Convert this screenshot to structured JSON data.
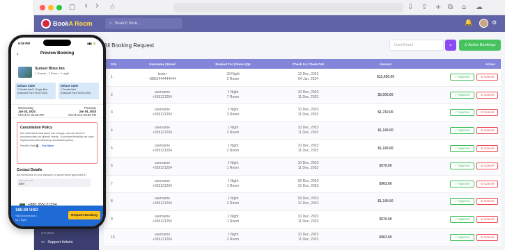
{
  "browser": {
    "back": "‹",
    "forward": "›",
    "tab_icon": "▢",
    "star": "☆"
  },
  "appbar": {
    "logo_text_1": "Book",
    "logo_text_2": "A Room",
    "search_placeholder": "Search here...",
    "search_icon": "⌕",
    "bell_icon": "🔔",
    "gear_icon": "⚙"
  },
  "page": {
    "title": "All Booking Request",
    "filter_placeholder": "User/Email",
    "filter_search_icon": "⌕",
    "active_button": "⊙ Active Bookings"
  },
  "table": {
    "headers": [
      "S.N.",
      "Username | Email",
      "Booked For | Room Qty",
      "Check In | Check Out",
      "Amount",
      "Action"
    ],
    "approve_label": "✓ Approve",
    "cancel_label": "⊘ Cancel",
    "rows": [
      {
        "sn": "1",
        "user": "tester",
        "email": "+8801444444444",
        "booked": "33 Night",
        "rooms": "2 Room",
        "checkin": "12 Dec, 2023",
        "checkout": "04 Jan, 2024",
        "amount": "$12,450.00"
      },
      {
        "sn": "2",
        "user": "username",
        "email": "+355121254",
        "booked": "1 Night",
        "rooms": "7 Room",
        "checkin": "10 Dec, 2023",
        "checkout": "11 Dec, 2023",
        "amount": "$3,005.60"
      },
      {
        "sn": "3",
        "user": "username",
        "email": "+355121254",
        "booked": "1 Night",
        "rooms": "3 Room",
        "checkin": "10 Dec, 2023",
        "checkout": "11 Dec, 2023",
        "amount": "$1,710.00"
      },
      {
        "sn": "4",
        "user": "username",
        "email": "+355121254",
        "booked": "1 Night",
        "rooms": "2 Room",
        "checkin": "10 Dec, 2023",
        "checkout": "11 Dec, 2023",
        "amount": "$1,140.00"
      },
      {
        "sn": "5",
        "user": "username",
        "email": "+355121254",
        "booked": "1 Night",
        "rooms": "2 Room",
        "checkin": "10 Dec, 2023",
        "checkout": "11 Dec, 2023",
        "amount": "$1,140.00"
      },
      {
        "sn": "6",
        "user": "username",
        "email": "+355121254",
        "booked": "1 Night",
        "rooms": "1 Room",
        "checkin": "10 Dec, 2023",
        "checkout": "11 Dec, 2023",
        "amount": "$570.00"
      },
      {
        "sn": "7",
        "user": "username",
        "email": "+355121254",
        "booked": "1 Night",
        "rooms": "1 Room",
        "checkin": "09 Dec, 2023",
        "checkout": "10 Dec, 2023",
        "amount": "$963.60"
      },
      {
        "sn": "8",
        "user": "username",
        "email": "+355121254",
        "booked": "1 Night",
        "rooms": "2 Room",
        "checkin": "09 Dec, 2023",
        "checkout": "10 Dec, 2023",
        "amount": "$1,140.00"
      },
      {
        "sn": "9",
        "user": "username",
        "email": "+355121254",
        "booked": "1 Night",
        "rooms": "1 Room",
        "checkin": "10 Dec, 2023",
        "checkout": "11 Dec, 2023",
        "amount": "$570.00"
      },
      {
        "sn": "10",
        "user": "username",
        "email": "+355121254",
        "booked": "1 Night",
        "rooms": "2 Room",
        "checkin": "10 Dec, 2023",
        "checkout": "11 Dec, 2023",
        "amount": "$963.60"
      }
    ]
  },
  "sidebar": {
    "others_label": "OTHERS",
    "support_label": "Support tickets",
    "support_icon": "▭"
  },
  "phone": {
    "time": "6:39 PM",
    "status_right": "▮▮▮ 🔋",
    "title": "Preview Booking",
    "back_icon": "‹",
    "hotel_name": "Sunset Bliss Inn",
    "hotel_meta": "1 Guests · 2 Room · 1 night",
    "room_a_title": "Deluxe Suite",
    "room_a_bed": "1 Double Bed 1 Single Bed",
    "room_a_price": "(Discount Fare 90.00 USD)",
    "room_b_title": "Deluxe Suite",
    "room_b_bed": "1 Double Bed",
    "room_b_price": "(Discount Fare 90.00 USD)",
    "checkin_day": "Wednesday",
    "checkin_date": "Jan 03, 2024",
    "checkin_time": "Check In: 02:56 PM",
    "checkout_day": "Thursday",
    "checkout_date": "Jan 04, 2024",
    "checkout_time": "Check Out: 08:56 PM",
    "policy_title": "Cancellation Policy",
    "policy_text": "We understand that plans can change, and we strive to accommodate our guests' needs. To provide flexibility, we have implemented the following cancellation policy:",
    "policy_more_prefix": "Flexible Rate ▓ ...",
    "policy_more_link": "See More",
    "contact_title": "Contact Details",
    "contact_text": "As mentioned on your passport or government approved ID",
    "name_label": "Enter your name",
    "name_value": "user",
    "phone_number": "+880 355121254",
    "footer_price": "180.00 USD",
    "footer_tax": "+$18.00 taxes and c",
    "footer_nights": "for 1 Night",
    "request_button": "Request Booking"
  }
}
